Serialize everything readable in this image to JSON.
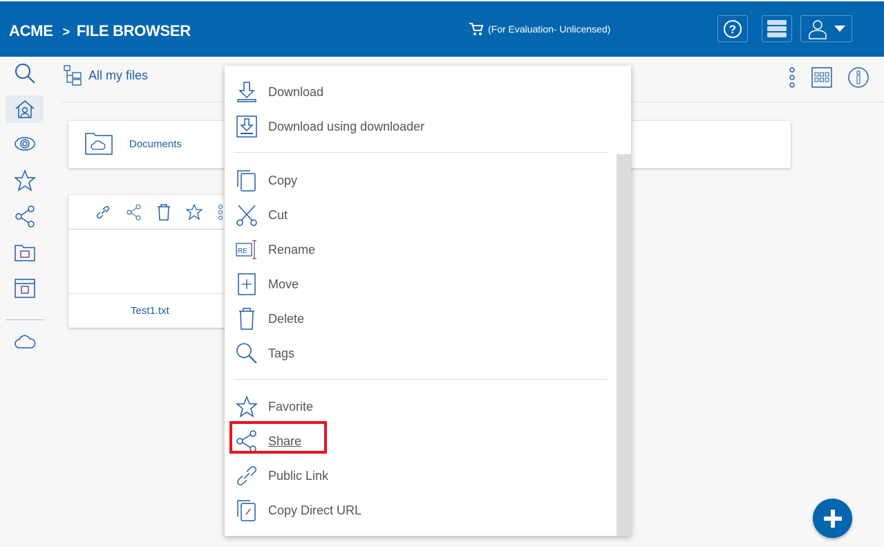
{
  "header": {
    "brand": "ACME",
    "separator": ">",
    "title": "FILE BROWSER",
    "license": "(For Evaluation- Unlicensed)",
    "accent": "#0566b0"
  },
  "sidebar": {
    "items": [
      "search-icon",
      "home-icon",
      "eye-icon",
      "star-icon",
      "share-icon",
      "drive-icon",
      "dashboard-icon",
      "cloud-icon"
    ]
  },
  "breadcrumb": {
    "label": "All my files"
  },
  "folders": [
    {
      "name": "Documents"
    }
  ],
  "files": [
    {
      "name": "Test1.txt"
    }
  ],
  "context_menu": {
    "items": [
      {
        "label": "Download",
        "icon": "download-icon"
      },
      {
        "label": "Download using downloader",
        "icon": "downloader-icon"
      },
      {
        "label": "Copy",
        "icon": "copy-icon"
      },
      {
        "label": "Cut",
        "icon": "cut-icon"
      },
      {
        "label": "Rename",
        "icon": "rename-icon"
      },
      {
        "label": "Move",
        "icon": "move-icon"
      },
      {
        "label": "Delete",
        "icon": "delete-icon"
      },
      {
        "label": "Tags",
        "icon": "tags-icon"
      },
      {
        "label": "Favorite",
        "icon": "star-icon"
      },
      {
        "label": "Share",
        "icon": "share-icon"
      },
      {
        "label": "Public Link",
        "icon": "link-icon"
      },
      {
        "label": "Copy Direct URL",
        "icon": "url-icon"
      }
    ]
  },
  "highlight_color": "#e8141c"
}
